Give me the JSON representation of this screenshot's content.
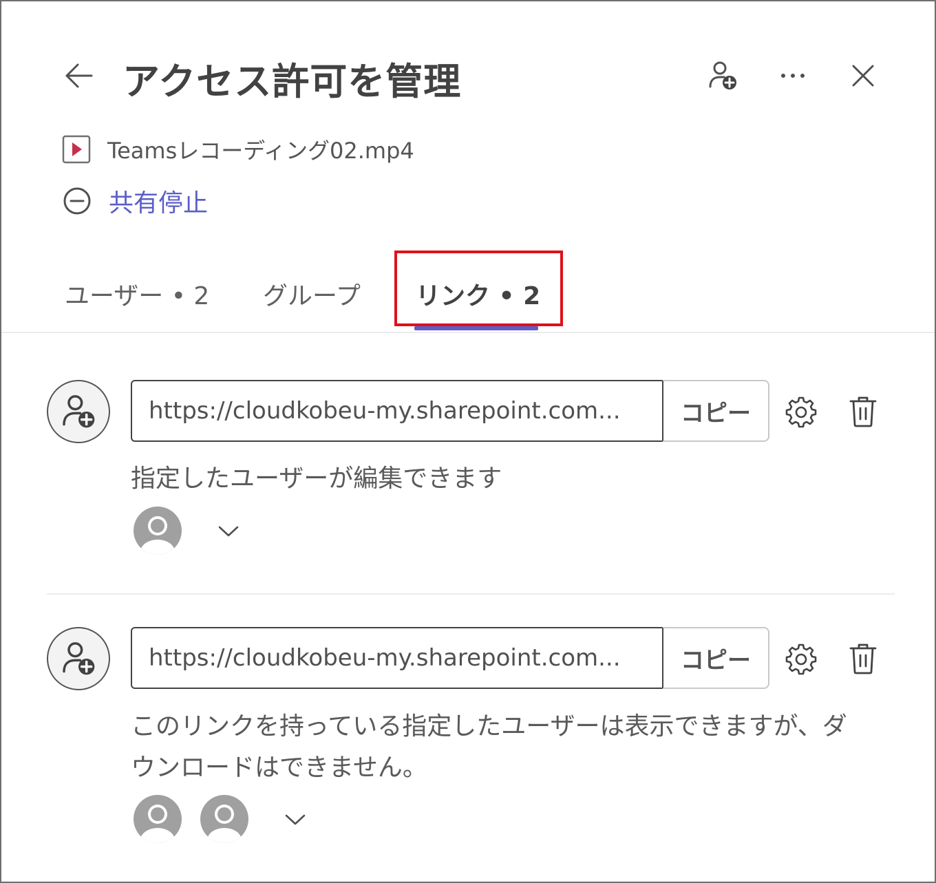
{
  "header": {
    "title": "アクセス許可を管理",
    "back_icon": "arrow-left-icon",
    "add_person_icon": "person-add-icon",
    "more_icon": "more-horizontal-icon",
    "close_icon": "close-icon"
  },
  "file": {
    "icon": "video-file-icon",
    "name": "Teamsレコーディング02.mp4"
  },
  "stop_sharing": {
    "icon": "minus-circle-icon",
    "label": "共有停止"
  },
  "tabs": [
    {
      "label": "ユーザー • 2",
      "active": false
    },
    {
      "label": "グループ",
      "active": false
    },
    {
      "label": "リンク • 2",
      "active": true
    }
  ],
  "links": [
    {
      "url": "https://cloudkobeu-my.sharepoint.com...",
      "copy_label": "コピー",
      "description": "指定したユーザーが編集できます",
      "users": [
        "user-avatar-icon"
      ]
    },
    {
      "url": "https://cloudkobeu-my.sharepoint.com...",
      "copy_label": "コピー",
      "description": "このリンクを持っている指定したユーザーは表示できますが、ダウンロードはできません。",
      "users": [
        "user-avatar-icon",
        "user-avatar-icon"
      ]
    }
  ],
  "colors": {
    "accent": "#5b5fc7",
    "highlight": "#e0101a",
    "text": "#424242"
  }
}
